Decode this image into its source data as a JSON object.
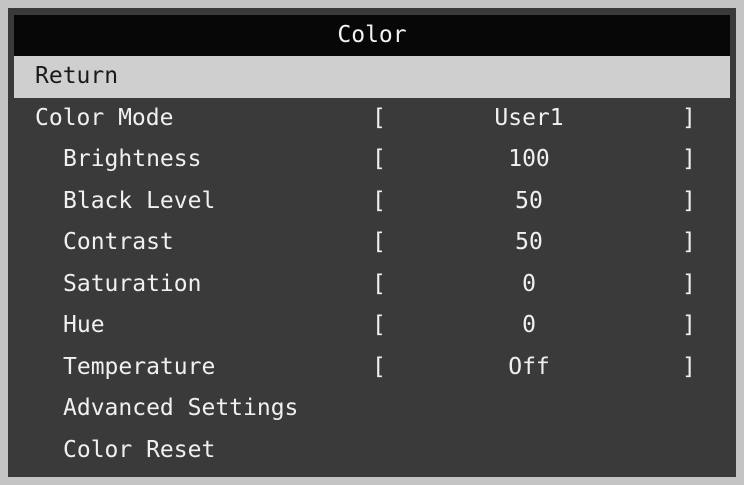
{
  "title": "Color",
  "menu": {
    "return": {
      "label": "Return"
    },
    "color_mode": {
      "label": "Color Mode",
      "value": "User1"
    },
    "brightness": {
      "label": "Brightness",
      "value": "100"
    },
    "black_level": {
      "label": "Black Level",
      "value": "50"
    },
    "contrast": {
      "label": "Contrast",
      "value": "50"
    },
    "saturation": {
      "label": "Saturation",
      "value": "0"
    },
    "hue": {
      "label": "Hue",
      "value": "0"
    },
    "temperature": {
      "label": "Temperature",
      "value": "Off"
    },
    "advanced_settings": {
      "label": "Advanced Settings"
    },
    "color_reset": {
      "label": "Color Reset"
    }
  },
  "brackets": {
    "open": "[",
    "close": "]"
  },
  "colors": {
    "title_bg": "#070707",
    "panel_bg": "#3a3a3a",
    "highlight_bg": "#cfcfcf",
    "text": "#f0f0f0"
  }
}
